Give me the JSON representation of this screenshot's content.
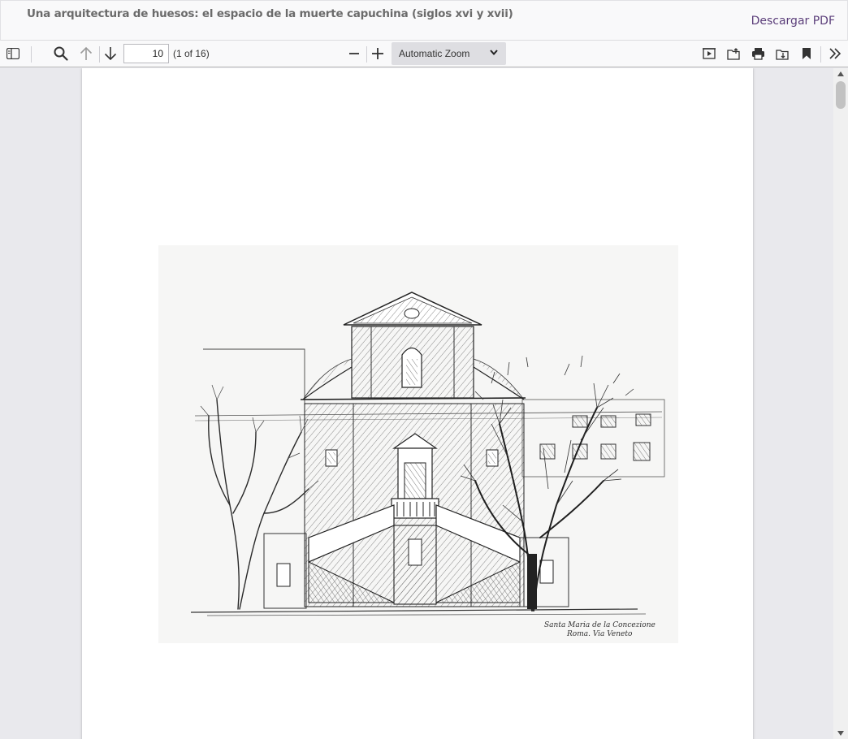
{
  "header": {
    "title": "Una arquitectura de huesos: el espacio de la muerte capuchina (siglos xvi y xvii)",
    "download_label": "Descargar PDF"
  },
  "toolbar": {
    "page_number": "10",
    "page_count": "(1 of 16)",
    "zoom": "Automatic Zoom",
    "icons": [
      "sidebar-toggle-icon",
      "search-icon",
      "arrow-up-icon",
      "arrow-down-icon",
      "zoom-out-icon",
      "zoom-in-icon",
      "chevron-down-icon",
      "presentation-icon",
      "open-file-icon",
      "print-icon",
      "save-icon",
      "bookmark-icon",
      "double-chevron-right-icon"
    ]
  },
  "figure": {
    "caption_handwritten_line1": "Santa Maria de la Concezione",
    "caption_handwritten_line2": "Roma. Via Veneto"
  },
  "colors": {
    "accent_link": "#5b3e7a",
    "toolbar_bg": "#f9f9fa",
    "viewer_bg": "#e9e9ed",
    "ink": "#2a2a2a"
  }
}
